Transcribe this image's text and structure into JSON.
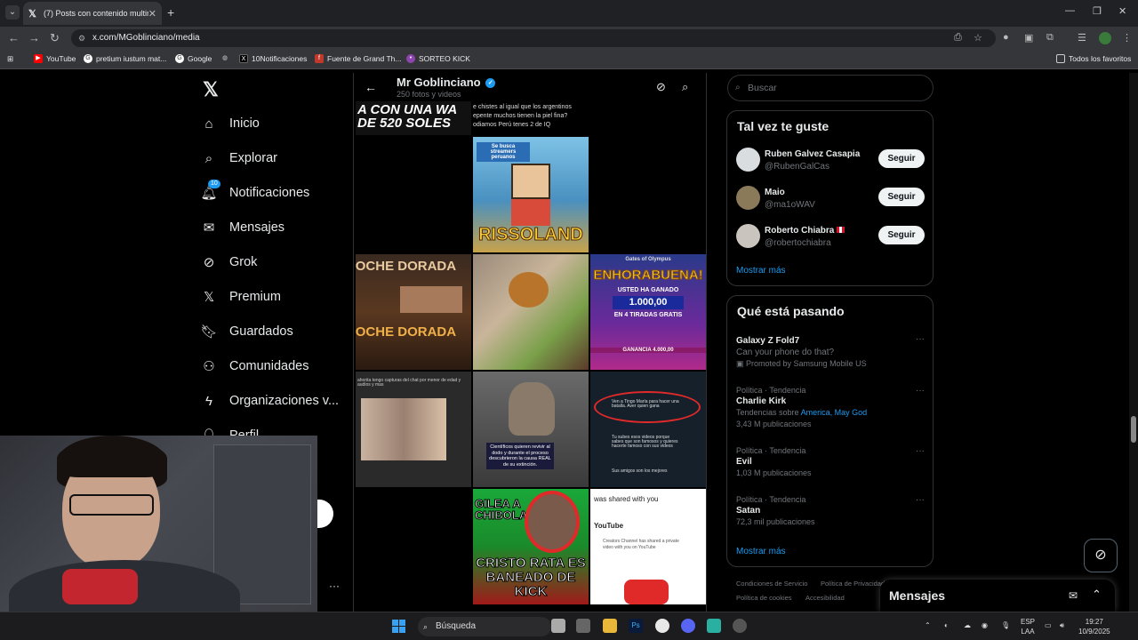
{
  "browser": {
    "tab_title": "(7) Posts con contenido multim",
    "url": "x.com/MGoblinciano/media",
    "bookmarks": [
      "YouTube",
      "pretium iustum mat...",
      "Google",
      "10Notificaciones",
      "Fuente de Grand Th...",
      "SORTEO KICK"
    ],
    "all_bookmarks": "Todos los favoritos"
  },
  "nav": {
    "items": [
      "Inicio",
      "Explorar",
      "Notificaciones",
      "Mensajes",
      "Grok",
      "Premium",
      "Guardados",
      "Comunidades",
      "Organizaciones v...",
      "Perfil"
    ],
    "notif_badge": "10"
  },
  "profile": {
    "name": "Mr Goblinciano",
    "count": "250 fotos y videos"
  },
  "media": {
    "top_caption_left": "A CON UNA WA DE 520 SOLES",
    "top_caption_right": "e chistes al igual que los argentinos epente muchos tienen la piel fina? odiamos Perú tenes 2 de IQ",
    "rissoland": "RISSOLAND",
    "rissoland_top": "Se busca streamers peruanos",
    "noche": "NOCHE DORADA",
    "enhorabuena": "ENHORABUENA!",
    "enhorabuena_sub": "USTED HA GANADO",
    "enhorabuena_amount": "1.000,00",
    "enhorabuena_spins": "EN 4 TIRADAS GRATIS",
    "enhorabuena_total": "GANANCIA 4.000,00",
    "gates": "Gates of Olympus",
    "dino_caption": "Científicos quieren revivir al dodo y durante el proceso descubrieron la causa REAL de su extinción.",
    "chat_line1": "Ven a Tingo María para hacer una batalla. Aver quien gana",
    "chat_line2": "Tu subes esos videos porque sabes que son famosos y quieres hacerte famoso con sus videos",
    "chat_line3": "Sus amigos son los mejores",
    "chat_blur_header": "ahorita tengo capturas del chat por menor de edad y audios y mas",
    "chibolas_top": "GILEA A CHIBOLAS",
    "chibolas_bottom": "CRISTO RATA ES BANEADO DE KICK",
    "yt_shared": "was shared with you",
    "yt_brand": "YouTube",
    "yt_text": "Creators Channel has shared a private video with you on YouTube"
  },
  "sidebar": {
    "search_placeholder": "Buscar",
    "suggest_title": "Tal vez te guste",
    "suggestions": [
      {
        "name": "Ruben Galvez Casapia",
        "handle": "@RubenGalCas",
        "button": "Seguir"
      },
      {
        "name": "Maio",
        "handle": "@ma1oWAV",
        "button": "Seguir"
      },
      {
        "name": "Roberto Chiabra",
        "handle": "@robertochiabra",
        "button": "Seguir"
      }
    ],
    "show_more": "Mostrar más",
    "trends_title": "Qué está pasando",
    "trends": [
      {
        "context": "",
        "title": "Galaxy Z Fold7",
        "count": "Can your phone do that?",
        "promo": "Promoted by Samsung Mobile US"
      },
      {
        "context": "Política · Tendencia",
        "title": "Charlie Kirk",
        "count": "3,43 M publicaciones",
        "related_prefix": "Tendencias sobre",
        "related": "America, May God"
      },
      {
        "context": "Política · Tendencia",
        "title": "Evil",
        "count": "1,03 M publicaciones"
      },
      {
        "context": "Política · Tendencia",
        "title": "Satan",
        "count": "72,3 mil publicaciones"
      }
    ],
    "trends_more": "Mostrar más",
    "footer1": "Condiciones de Servicio",
    "footer2": "Política de Privacidad",
    "footer3": "Política de cookies",
    "footer4": "Accesibilidad",
    "messages": "Mensajes"
  },
  "taskbar": {
    "search": "Búsqueda",
    "lang1": "ESP",
    "lang2": "LAA",
    "time": "19:27",
    "date": "10/9/2025"
  }
}
